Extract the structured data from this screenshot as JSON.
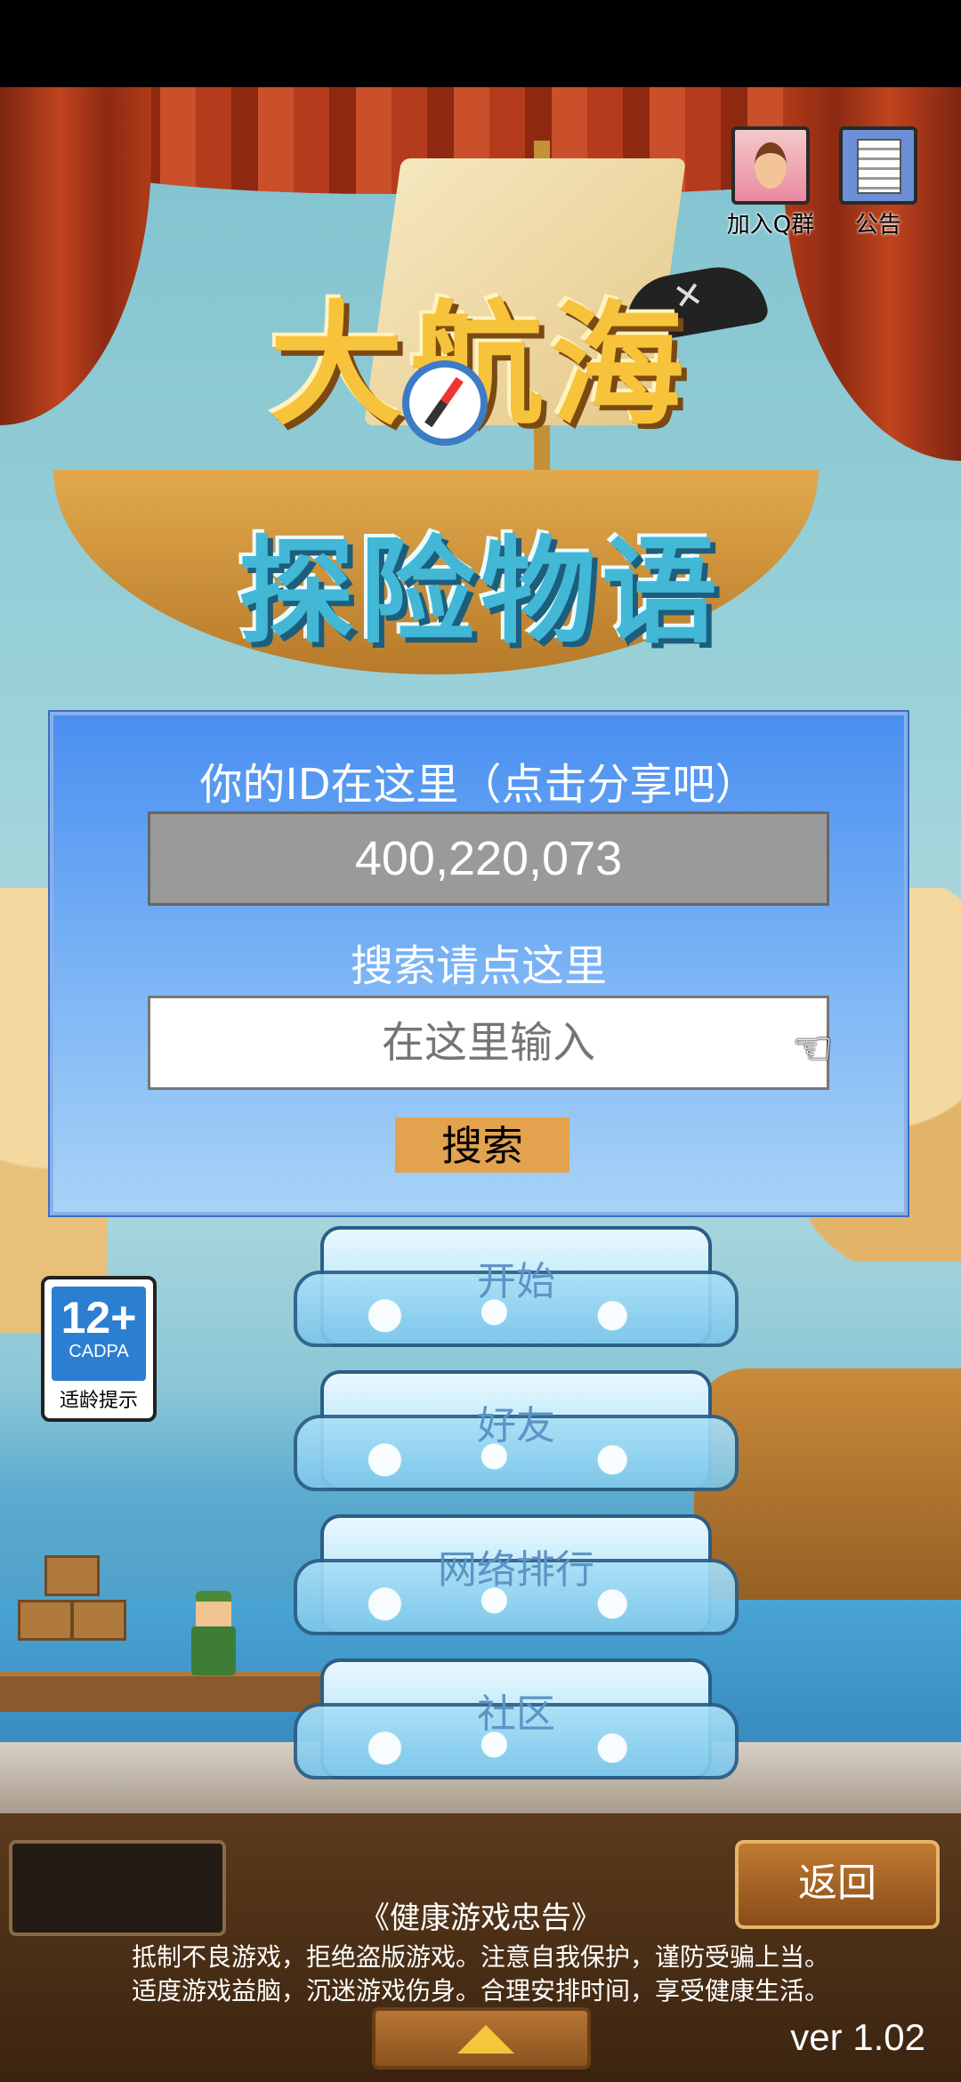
{
  "top_buttons": {
    "join_qq_label": "加入Q群",
    "notice_label": "公告"
  },
  "logo": {
    "line1": "大航海",
    "line2": "探险物语"
  },
  "id_panel": {
    "title": "你的ID在这里（点击分享吧）",
    "id_value": "400,220,073",
    "search_title": "搜索请点这里",
    "search_placeholder": "在这里输入",
    "search_button": "搜索"
  },
  "age_badge": {
    "number": "12+",
    "org": "CADPA",
    "tip": "适龄提示"
  },
  "menu": [
    {
      "label": "开始"
    },
    {
      "label": "好友"
    },
    {
      "label": "网络排行"
    },
    {
      "label": "社区"
    }
  ],
  "bottom": {
    "back_label": "返回",
    "health_title": "《健康游戏忠告》",
    "health_line1": "抵制不良游戏，拒绝盗版游戏。注意自我保护，谨防受骗上当。",
    "health_line2": "适度游戏益脑，沉迷游戏伤身。合理安排时间，享受健康生活。",
    "version": "ver 1.02"
  },
  "colors": {
    "panel_blue": "#4a8ff0",
    "search_button": "#e2a24e",
    "menu_text": "#5d94c6"
  },
  "icons": [
    "join-qq-group-icon",
    "notice-icon",
    "pointing-hand-icon",
    "up-arrow-icon",
    "compass-icon"
  ]
}
